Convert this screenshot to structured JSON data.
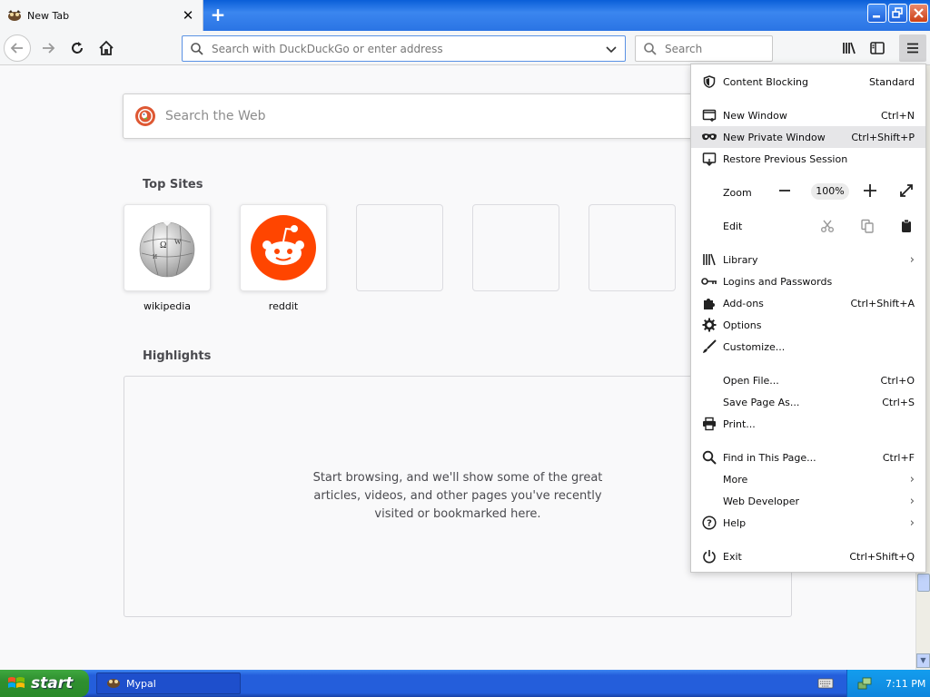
{
  "window": {
    "tab_title": "New Tab"
  },
  "navbar": {
    "url_placeholder": "Search with DuckDuckGo or enter address",
    "search_placeholder": "Search"
  },
  "newtab": {
    "web_search_placeholder": "Search the Web",
    "top_sites_title": "Top Sites",
    "top_sites": [
      {
        "label": "wikipedia"
      },
      {
        "label": "reddit"
      }
    ],
    "highlights_title": "Highlights",
    "highlights_message": "Start browsing, and we'll show some of the great articles, videos, and other pages you've recently visited or bookmarked here."
  },
  "menu": {
    "content_blocking": {
      "label": "Content Blocking",
      "value": "Standard"
    },
    "new_window": {
      "label": "New Window",
      "shortcut": "Ctrl+N"
    },
    "new_private_window": {
      "label": "New Private Window",
      "shortcut": "Ctrl+Shift+P"
    },
    "restore_session": {
      "label": "Restore Previous Session"
    },
    "zoom": {
      "label": "Zoom",
      "value": "100%"
    },
    "edit": {
      "label": "Edit"
    },
    "library": {
      "label": "Library"
    },
    "logins": {
      "label": "Logins and Passwords"
    },
    "addons": {
      "label": "Add-ons",
      "shortcut": "Ctrl+Shift+A"
    },
    "options": {
      "label": "Options"
    },
    "customize": {
      "label": "Customize..."
    },
    "open_file": {
      "label": "Open File...",
      "shortcut": "Ctrl+O"
    },
    "save_page": {
      "label": "Save Page As...",
      "shortcut": "Ctrl+S"
    },
    "print": {
      "label": "Print..."
    },
    "find": {
      "label": "Find in This Page...",
      "shortcut": "Ctrl+F"
    },
    "more": {
      "label": "More"
    },
    "web_developer": {
      "label": "Web Developer"
    },
    "help": {
      "label": "Help"
    },
    "exit": {
      "label": "Exit",
      "shortcut": "Ctrl+Shift+Q"
    }
  },
  "taskbar": {
    "start_label": "start",
    "task_label": "Mypal",
    "clock": "7:11 PM"
  },
  "colors": {
    "accent": "#0a84ff",
    "reddit": "#ff4500",
    "duckduckgo": "#de5833",
    "xp_blue": "#245edb",
    "xp_green": "#2f8f2f"
  }
}
